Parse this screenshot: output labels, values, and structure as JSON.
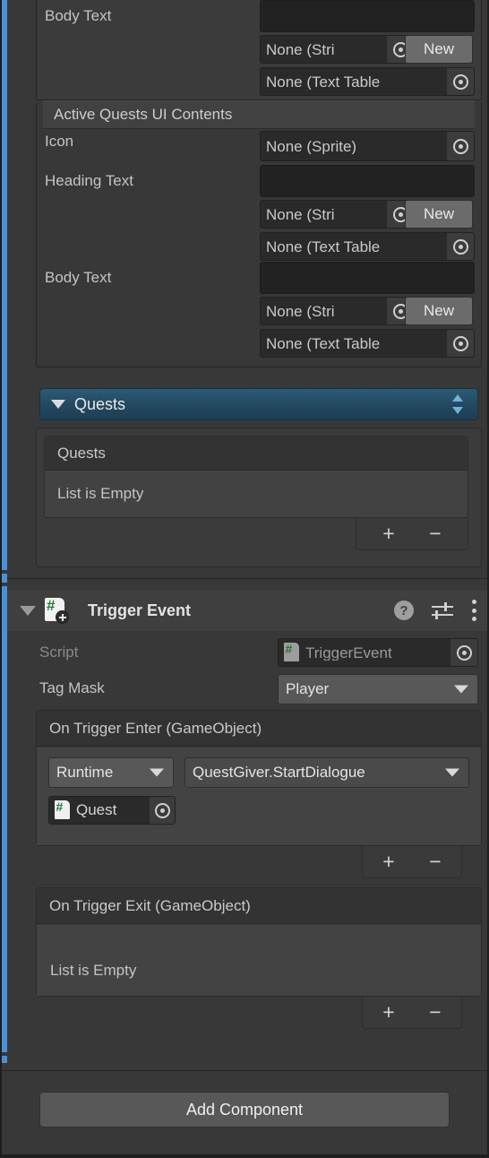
{
  "inspector": {
    "top_section": {
      "rows": [
        {
          "label": "Body Text",
          "empty_field": true
        },
        {
          "localized_value": "None (Stri",
          "new_button": "New"
        },
        {
          "table_value": "None (Text Table"
        }
      ]
    },
    "active_quests_section": {
      "header": "Active Quests UI Contents",
      "icon_row": {
        "label": "Icon",
        "value": "None (Sprite)"
      },
      "heading_row": {
        "label": "Heading Text",
        "localized_value": "None (Stri",
        "new_button": "New",
        "table_value": "None (Text Table"
      },
      "body_row": {
        "label": "Body Text",
        "localized_value": "None (Stri",
        "new_button": "New",
        "table_value": "None (Text Table"
      }
    },
    "quests_foldout": {
      "title": "Quests",
      "expanded": true,
      "list": {
        "header": "Quests",
        "empty_text": "List is Empty",
        "add_button": "+",
        "remove_button": "−"
      }
    },
    "trigger_event_component": {
      "title": "Trigger Event",
      "expanded": true,
      "icons": {
        "script": "csharp-script-icon",
        "help": "?",
        "preset": "preset-icon",
        "menu": "kebab-menu-icon"
      },
      "script_row": {
        "label": "Script",
        "value": "TriggerEvent"
      },
      "tag_mask_row": {
        "label": "Tag Mask",
        "value": "Player"
      },
      "on_trigger_enter": {
        "header": "On Trigger Enter (GameObject)",
        "entries": [
          {
            "call_state": "Runtime ",
            "function": "QuestGiver.StartDialogue",
            "argument": "Quest"
          }
        ],
        "add_button": "+",
        "remove_button": "−"
      },
      "on_trigger_exit": {
        "header": "On Trigger Exit (GameObject)",
        "empty_text": "List is Empty",
        "add_button": "+",
        "remove_button": "−"
      }
    },
    "add_component_button": "Add Component"
  },
  "colors": {
    "background": "#383838",
    "accent_blue": "#4a90d9",
    "foldout_header": "#23485f",
    "field_dark": "#2a2a2a",
    "button_grey": "#585858",
    "script_green": "#1f7a33"
  }
}
